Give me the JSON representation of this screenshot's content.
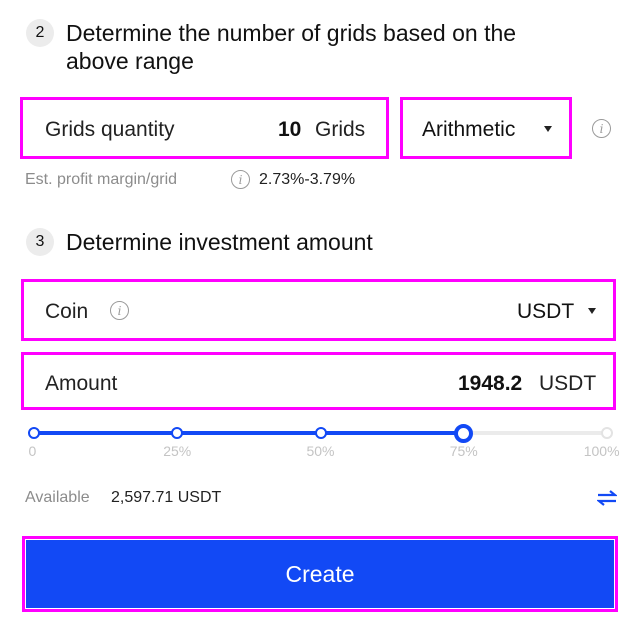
{
  "step2": {
    "number": "2",
    "title_line1": "Determine the number of grids based on the",
    "title_line2": "above range",
    "grids_field": {
      "label": "Grids quantity",
      "value": "10",
      "unit": "Grids"
    },
    "mode_select": {
      "selected": "Arithmetic"
    },
    "profit_hint": {
      "label": "Est. profit margin/grid",
      "value": "2.73%-3.79%"
    }
  },
  "step3": {
    "number": "3",
    "title": "Determine investment amount",
    "coin_field": {
      "label": "Coin",
      "selected": "USDT"
    },
    "amount_field": {
      "label": "Amount",
      "value": "1948.2",
      "unit": "USDT"
    },
    "slider": {
      "value_percent": 75,
      "ticks": [
        "0",
        "25%",
        "50%",
        "75%",
        "100%"
      ],
      "tick_values": [
        0,
        25,
        50,
        75,
        100
      ]
    },
    "available": {
      "label": "Available",
      "value": "2,597.71 USDT"
    }
  },
  "actions": {
    "create_label": "Create"
  },
  "colors": {
    "accent": "#1249f5",
    "highlight": "#ff00ff",
    "track_inactive": "#ebebeb"
  }
}
